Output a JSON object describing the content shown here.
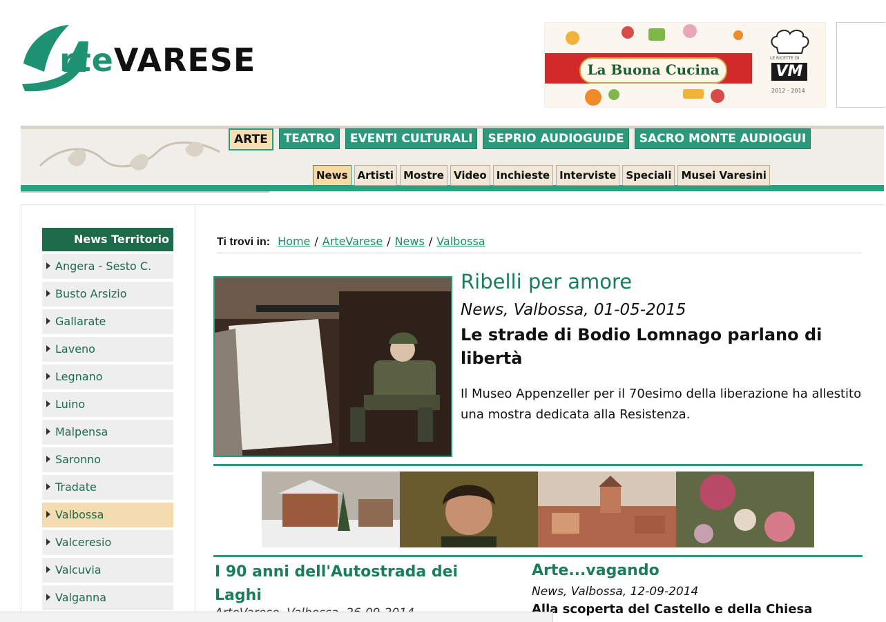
{
  "logo": {
    "prefix": "A",
    "green": "rte",
    "black": "VARESE"
  },
  "banner": {
    "title": "La Buona Cucina",
    "brand": "VM",
    "top_text": "LE RICETTE DI",
    "years": "2012 - 2014"
  },
  "main_nav": [
    "ARTE",
    "TEATRO",
    "EVENTI CULTURALI",
    "SEPRIO AUDIOGUIDE",
    "SACRO MONTE AUDIOGUI"
  ],
  "sub_nav": [
    "News",
    "Artisti",
    "Mostre",
    "Video",
    "Inchieste",
    "Interviste",
    "Speciali",
    "Musei Varesini"
  ],
  "sidebar": {
    "title": "News Territorio",
    "items": [
      "Angera - Sesto C.",
      "Busto Arsizio",
      "Gallarate",
      "Laveno",
      "Legnano",
      "Luino",
      "Malpensa",
      "Saronno",
      "Tradate",
      "Valbossa",
      "Valceresio",
      "Valcuvia",
      "Valganna"
    ]
  },
  "breadcrumb": {
    "label": "Ti trovi in:",
    "links": [
      "Home",
      "ArteVarese",
      "News",
      "Valbossa"
    ],
    "separator": "/"
  },
  "featured": {
    "title": "Ribelli per amore",
    "meta": "News, Valbossa, 01-05-2015",
    "subtitle": "Le strade di Bodio Lomnago parlano di libertà",
    "description": "Il Museo Appenzeller per il 70esimo della liberazione ha allestito una mostra dedicata alla Resistenza."
  },
  "articles": [
    {
      "title": "I 90 anni dell'Autostrada dei Laghi",
      "meta": "ArteVarese, Valbossa, 26-09-2014"
    },
    {
      "title": "Arte...vagando",
      "meta": "News, Valbossa, 12-09-2014",
      "subtitle": "Alla scoperta del Castello e della Chiesa"
    }
  ],
  "colors": {
    "brand_green": "#2a9a7a",
    "dark_green": "#1e6b4b",
    "active_tab": "#f6dfb3",
    "frame_blue": "#5b7fb5"
  }
}
